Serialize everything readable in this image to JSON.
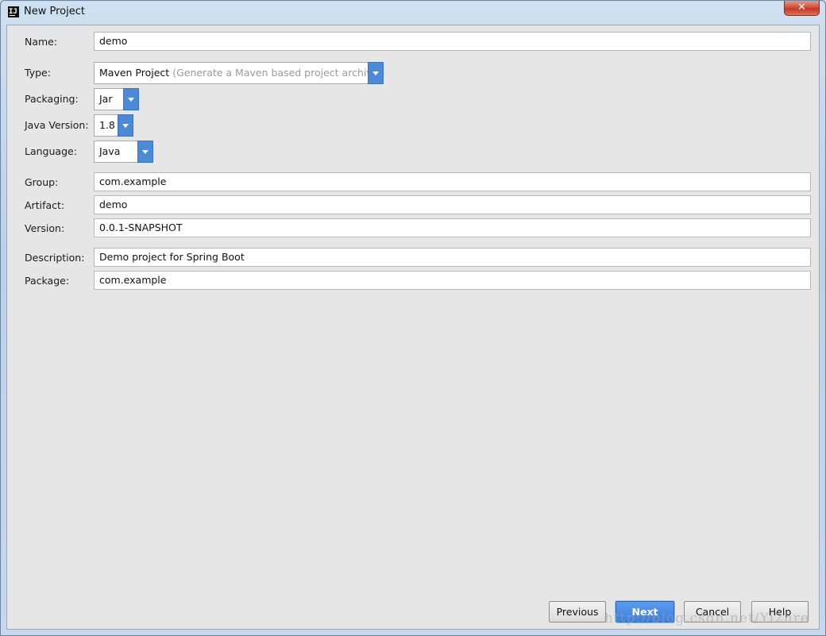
{
  "window": {
    "title": "New Project",
    "icon": "intellij-icon",
    "close_label": "✕"
  },
  "form": {
    "name": {
      "label": "Name:",
      "value": "demo"
    },
    "type": {
      "label": "Type:",
      "value": "Maven Project",
      "hint": "(Generate a Maven based project archive)"
    },
    "packaging": {
      "label": "Packaging:",
      "value": "Jar"
    },
    "java_version": {
      "label": "Java Version:",
      "value": "1.8"
    },
    "language": {
      "label": "Language:",
      "value": "Java"
    },
    "group": {
      "label": "Group:",
      "value": "com.example"
    },
    "artifact": {
      "label": "Artifact:",
      "value": "demo"
    },
    "version": {
      "label": "Version:",
      "value": "0.0.1-SNAPSHOT"
    },
    "description": {
      "label": "Description:",
      "value": "Demo project for Spring Boot"
    },
    "package": {
      "label": "Package:",
      "value": "com.example"
    }
  },
  "buttons": {
    "previous": "Previous",
    "next": "Next",
    "cancel": "Cancel",
    "help": "Help"
  },
  "watermark": "http://blog.csdn.net/Yi2hre",
  "colors": {
    "accent": "#4a8ad8",
    "close": "#c23a26",
    "panel": "#e6e6e6"
  }
}
